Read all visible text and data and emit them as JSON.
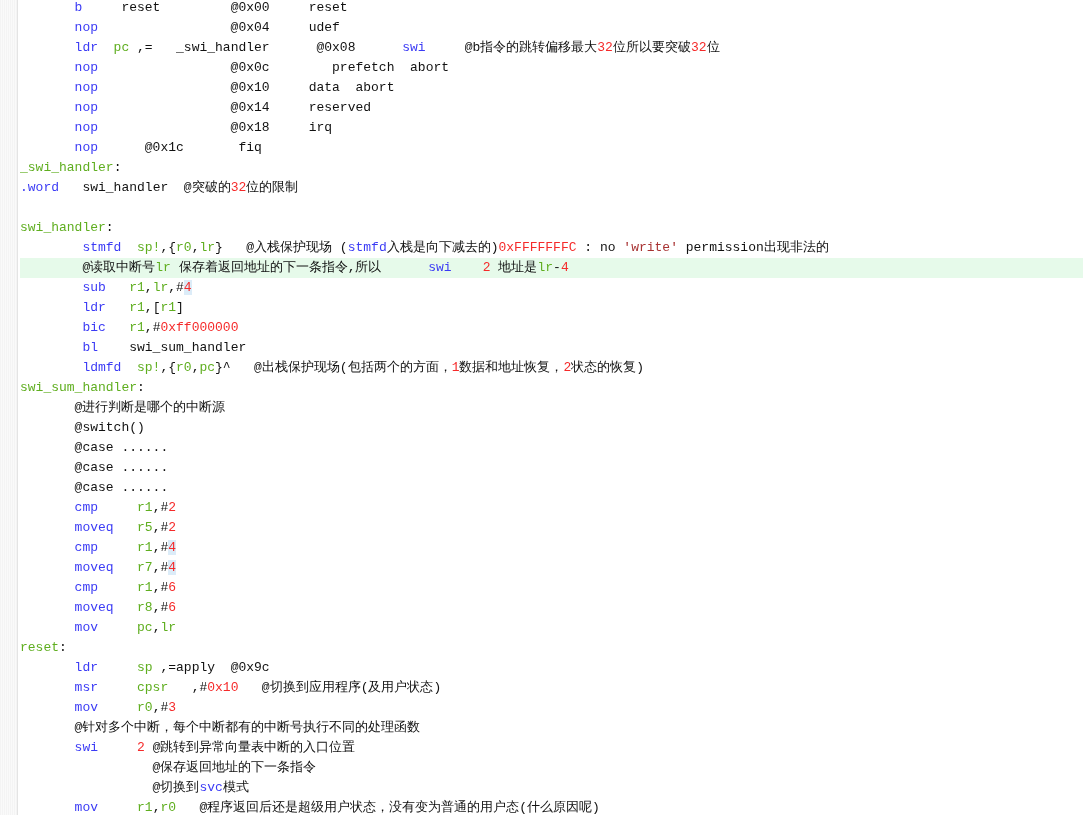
{
  "editor": {
    "lines": [
      {
        "kind": "code",
        "current": false,
        "tokens": [
          {
            "kind": "keyword",
            "text": "b"
          },
          {
            "kind": "plain",
            "text": "     reset         @0x00     reset"
          }
        ]
      },
      {
        "kind": "code",
        "current": false,
        "tokens": [
          {
            "kind": "keyword",
            "text": "nop"
          },
          {
            "kind": "plain",
            "text": "                 @0x04     udef"
          }
        ]
      },
      {
        "kind": "code",
        "current": false,
        "tokens": [
          {
            "kind": "keyword",
            "text": "ldr  "
          },
          {
            "kind": "register",
            "text": "pc"
          },
          {
            "kind": "plain",
            "text": " ,=   _swi_handler      @0x08      "
          },
          {
            "kind": "keyword",
            "text": "swi"
          },
          {
            "kind": "plain",
            "text": "     @b指令的跳转偏移最大"
          },
          {
            "kind": "number",
            "text": "32"
          },
          {
            "kind": "plain",
            "text": "位所以要突破"
          },
          {
            "kind": "number",
            "text": "32"
          },
          {
            "kind": "plain",
            "text": "位"
          }
        ]
      },
      {
        "kind": "code",
        "current": false,
        "tokens": [
          {
            "kind": "keyword",
            "text": "nop"
          },
          {
            "kind": "plain",
            "text": "                 @0x0c        prefetch  abort"
          }
        ]
      },
      {
        "kind": "code",
        "current": false,
        "tokens": [
          {
            "kind": "keyword",
            "text": "nop"
          },
          {
            "kind": "plain",
            "text": "                 @0x10     data  abort"
          }
        ]
      },
      {
        "kind": "code",
        "current": false,
        "tokens": [
          {
            "kind": "keyword",
            "text": "nop"
          },
          {
            "kind": "plain",
            "text": "                 @0x14     reserved"
          }
        ]
      },
      {
        "kind": "code",
        "current": false,
        "tokens": [
          {
            "kind": "keyword",
            "text": "nop"
          },
          {
            "kind": "plain",
            "text": "                 @0x18     irq"
          }
        ]
      },
      {
        "kind": "code",
        "current": false,
        "tokens": [
          {
            "kind": "keyword",
            "text": "nop"
          },
          {
            "kind": "plain",
            "text": "      @0x1c       fiq"
          }
        ]
      },
      {
        "kind": "label",
        "current": false,
        "tokens": [
          {
            "kind": "label",
            "text": "_swi_handler"
          },
          {
            "kind": "plain",
            "text": ":"
          }
        ]
      },
      {
        "kind": "label",
        "current": false,
        "tokens": [
          {
            "kind": "keyword",
            "text": ".word"
          },
          {
            "kind": "plain",
            "text": "   swi_handler  @突破的"
          },
          {
            "kind": "number",
            "text": "32"
          },
          {
            "kind": "plain",
            "text": "位的限制"
          }
        ]
      },
      {
        "kind": "blank"
      },
      {
        "kind": "label",
        "current": false,
        "tokens": [
          {
            "kind": "label",
            "text": "swi_handler"
          },
          {
            "kind": "plain",
            "text": ":"
          }
        ]
      },
      {
        "kind": "nested",
        "current": false,
        "tokens": [
          {
            "kind": "keyword",
            "text": "stmfd  "
          },
          {
            "kind": "register",
            "text": "sp!"
          },
          {
            "kind": "plain",
            "text": ",{"
          },
          {
            "kind": "register",
            "text": "r0"
          },
          {
            "kind": "plain",
            "text": ","
          },
          {
            "kind": "register",
            "text": "lr"
          },
          {
            "kind": "plain",
            "text": "}   @入栈保护现场 ("
          },
          {
            "kind": "keyword",
            "text": "stmfd"
          },
          {
            "kind": "plain",
            "text": "入栈是向下减去的)"
          },
          {
            "kind": "number",
            "text": "0xFFFFFFFC"
          },
          {
            "kind": "plain",
            "text": " : no "
          },
          {
            "kind": "string",
            "text": "'write'"
          },
          {
            "kind": "plain",
            "text": " permission出现非法的"
          }
        ]
      },
      {
        "kind": "nested",
        "current": true,
        "tokens": [
          {
            "kind": "plain",
            "text": "@读取中断号"
          },
          {
            "kind": "register",
            "text": "lr"
          },
          {
            "kind": "plain",
            "text": " 保存着返回地址的下一条指令,所以      "
          },
          {
            "kind": "keyword",
            "text": "swi    "
          },
          {
            "kind": "number",
            "text": "2"
          },
          {
            "kind": "plain",
            "text": " 地址是"
          },
          {
            "kind": "register",
            "text": "lr"
          },
          {
            "kind": "plain",
            "text": "-"
          },
          {
            "kind": "number",
            "text": "4"
          }
        ]
      },
      {
        "kind": "nested",
        "current": false,
        "tokens": [
          {
            "kind": "keyword",
            "text": "sub   "
          },
          {
            "kind": "register",
            "text": "r1"
          },
          {
            "kind": "plain",
            "text": ","
          },
          {
            "kind": "register",
            "text": "lr"
          },
          {
            "kind": "plain",
            "text": ",#"
          },
          {
            "kind": "match",
            "text": "4"
          }
        ]
      },
      {
        "kind": "nested",
        "current": false,
        "tokens": [
          {
            "kind": "keyword",
            "text": "ldr   "
          },
          {
            "kind": "register",
            "text": "r1"
          },
          {
            "kind": "plain",
            "text": ",["
          },
          {
            "kind": "register",
            "text": "r1"
          },
          {
            "kind": "plain",
            "text": "]"
          }
        ]
      },
      {
        "kind": "nested",
        "current": false,
        "tokens": [
          {
            "kind": "keyword",
            "text": "bic   "
          },
          {
            "kind": "register",
            "text": "r1"
          },
          {
            "kind": "plain",
            "text": ",#"
          },
          {
            "kind": "number",
            "text": "0xff000000"
          }
        ]
      },
      {
        "kind": "nested",
        "current": false,
        "tokens": [
          {
            "kind": "keyword",
            "text": "bl"
          },
          {
            "kind": "plain",
            "text": "    swi_sum_handler"
          }
        ]
      },
      {
        "kind": "nested",
        "current": false,
        "tokens": [
          {
            "kind": "keyword",
            "text": "ldmfd  "
          },
          {
            "kind": "register",
            "text": "sp!"
          },
          {
            "kind": "plain",
            "text": ",{"
          },
          {
            "kind": "register",
            "text": "r0"
          },
          {
            "kind": "plain",
            "text": ","
          },
          {
            "kind": "register",
            "text": "pc"
          },
          {
            "kind": "plain",
            "text": "}^   @出栈保护现场(包括两个的方面，"
          },
          {
            "kind": "number",
            "text": "1"
          },
          {
            "kind": "plain",
            "text": "数据和地址恢复，"
          },
          {
            "kind": "number",
            "text": "2"
          },
          {
            "kind": "plain",
            "text": "状态的恢复)"
          }
        ]
      },
      {
        "kind": "label",
        "current": false,
        "tokens": [
          {
            "kind": "label",
            "text": "swi_sum_handler"
          },
          {
            "kind": "plain",
            "text": ":"
          }
        ]
      },
      {
        "kind": "code",
        "current": false,
        "tokens": [
          {
            "kind": "plain",
            "text": "@进行判断是哪个的中断源"
          }
        ]
      },
      {
        "kind": "code",
        "current": false,
        "tokens": [
          {
            "kind": "plain",
            "text": "@switch()"
          }
        ]
      },
      {
        "kind": "code",
        "current": false,
        "tokens": [
          {
            "kind": "plain",
            "text": "@case ......"
          }
        ]
      },
      {
        "kind": "code",
        "current": false,
        "tokens": [
          {
            "kind": "plain",
            "text": "@case ......"
          }
        ]
      },
      {
        "kind": "code",
        "current": false,
        "tokens": [
          {
            "kind": "plain",
            "text": "@case ......"
          }
        ]
      },
      {
        "kind": "code",
        "current": false,
        "tokens": [
          {
            "kind": "keyword",
            "text": "cmp     "
          },
          {
            "kind": "register",
            "text": "r1"
          },
          {
            "kind": "plain",
            "text": ",#"
          },
          {
            "kind": "number",
            "text": "2"
          }
        ]
      },
      {
        "kind": "code",
        "current": false,
        "tokens": [
          {
            "kind": "keyword",
            "text": "moveq   "
          },
          {
            "kind": "register",
            "text": "r5"
          },
          {
            "kind": "plain",
            "text": ",#"
          },
          {
            "kind": "number",
            "text": "2"
          }
        ]
      },
      {
        "kind": "code",
        "current": false,
        "tokens": [
          {
            "kind": "keyword",
            "text": "cmp     "
          },
          {
            "kind": "register",
            "text": "r1"
          },
          {
            "kind": "plain",
            "text": ",#"
          },
          {
            "kind": "match",
            "text": "4"
          }
        ]
      },
      {
        "kind": "code",
        "current": false,
        "tokens": [
          {
            "kind": "keyword",
            "text": "moveq   "
          },
          {
            "kind": "register",
            "text": "r7"
          },
          {
            "kind": "plain",
            "text": ",#"
          },
          {
            "kind": "match",
            "text": "4"
          }
        ]
      },
      {
        "kind": "code",
        "current": false,
        "tokens": [
          {
            "kind": "keyword",
            "text": "cmp     "
          },
          {
            "kind": "register",
            "text": "r1"
          },
          {
            "kind": "plain",
            "text": ",#"
          },
          {
            "kind": "number",
            "text": "6"
          }
        ]
      },
      {
        "kind": "code",
        "current": false,
        "tokens": [
          {
            "kind": "keyword",
            "text": "moveq   "
          },
          {
            "kind": "register",
            "text": "r8"
          },
          {
            "kind": "plain",
            "text": ",#"
          },
          {
            "kind": "number",
            "text": "6"
          }
        ]
      },
      {
        "kind": "code",
        "current": false,
        "tokens": [
          {
            "kind": "keyword",
            "text": "mov     "
          },
          {
            "kind": "register",
            "text": "pc"
          },
          {
            "kind": "plain",
            "text": ","
          },
          {
            "kind": "register",
            "text": "lr"
          }
        ]
      },
      {
        "kind": "label",
        "current": false,
        "tokens": [
          {
            "kind": "label",
            "text": "reset"
          },
          {
            "kind": "plain",
            "text": ":"
          }
        ]
      },
      {
        "kind": "code",
        "current": false,
        "tokens": [
          {
            "kind": "keyword",
            "text": "ldr     "
          },
          {
            "kind": "register",
            "text": "sp"
          },
          {
            "kind": "plain",
            "text": " ,=apply  @0x9c"
          }
        ]
      },
      {
        "kind": "code",
        "current": false,
        "tokens": [
          {
            "kind": "keyword",
            "text": "msr     "
          },
          {
            "kind": "register",
            "text": "cpsr"
          },
          {
            "kind": "plain",
            "text": "   ,#"
          },
          {
            "kind": "number",
            "text": "0x10"
          },
          {
            "kind": "plain",
            "text": "   @切换到应用程序(及用户状态)"
          }
        ]
      },
      {
        "kind": "code",
        "current": false,
        "tokens": [
          {
            "kind": "keyword",
            "text": "mov     "
          },
          {
            "kind": "register",
            "text": "r0"
          },
          {
            "kind": "plain",
            "text": ",#"
          },
          {
            "kind": "number",
            "text": "3"
          }
        ]
      },
      {
        "kind": "code",
        "current": false,
        "tokens": [
          {
            "kind": "plain",
            "text": "@针对多个中断，每个中断都有的中断号执行不同的处理函数"
          }
        ]
      },
      {
        "kind": "code",
        "current": false,
        "tokens": [
          {
            "kind": "keyword",
            "text": "swi     "
          },
          {
            "kind": "number",
            "text": "2"
          },
          {
            "kind": "plain",
            "text": " @跳转到异常向量表中断的入口位置"
          }
        ]
      },
      {
        "kind": "continuation",
        "current": false,
        "tokens": [
          {
            "kind": "plain",
            "text": "@保存返回地址的下一条指令"
          }
        ]
      },
      {
        "kind": "continuation",
        "current": false,
        "tokens": [
          {
            "kind": "plain",
            "text": "@切换到"
          },
          {
            "kind": "keyword",
            "text": "svc"
          },
          {
            "kind": "plain",
            "text": "模式"
          }
        ]
      },
      {
        "kind": "code",
        "current": false,
        "tokens": [
          {
            "kind": "keyword",
            "text": "mov     "
          },
          {
            "kind": "register",
            "text": "r1"
          },
          {
            "kind": "plain",
            "text": ","
          },
          {
            "kind": "register",
            "text": "r0"
          },
          {
            "kind": "plain",
            "text": "   @程序返回后还是超级用户状态，没有变为普通的用户态(什么原因呢)"
          }
        ]
      }
    ]
  }
}
